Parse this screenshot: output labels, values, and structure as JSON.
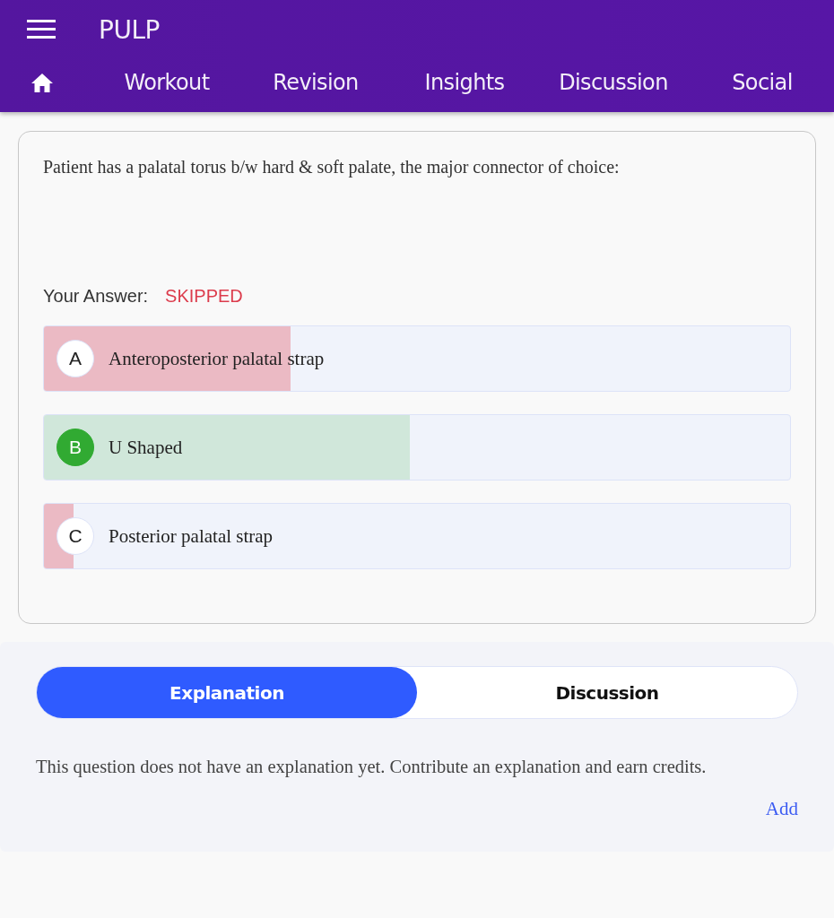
{
  "app_bar": {
    "title": "PULP"
  },
  "nav": {
    "items": [
      "Workout",
      "Revision",
      "Insights",
      "Discussion",
      "Social"
    ]
  },
  "question": {
    "text": "Patient has a palatal torus b/w hard & soft palate, the major connector of choice:",
    "answer_label": "Your Answer:",
    "answer_value": "SKIPPED",
    "options": [
      {
        "letter": "A",
        "text": "Anteroposterior palatal strap",
        "kind": "wrong",
        "level": 0.33
      },
      {
        "letter": "B",
        "text": "U Shaped",
        "kind": "correct",
        "level": 0.49
      },
      {
        "letter": "C",
        "text": "Posterior palatal strap",
        "kind": "wrong",
        "level": 0.04
      }
    ]
  },
  "tabs": [
    {
      "label": "Explanation",
      "selected": true
    },
    {
      "label": "Discussion",
      "selected": false
    }
  ],
  "explanation": {
    "text": "This question does not have an explanation yet. Contribute an explanation and earn credits.",
    "link": "Add"
  }
}
